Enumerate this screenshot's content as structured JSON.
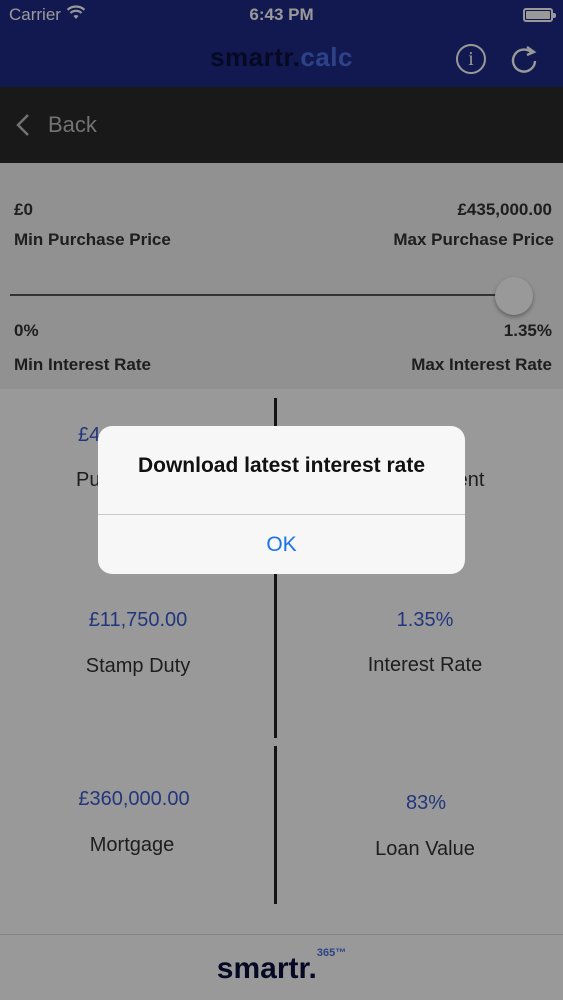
{
  "status_bar": {
    "carrier": "Carrier",
    "time": "6:43 PM"
  },
  "header": {
    "logo_main": "smartr.",
    "logo_accent": "calc",
    "info_icon": "info-icon",
    "refresh_icon": "refresh-icon"
  },
  "nav": {
    "back_label": "Back"
  },
  "slider": {
    "min_price_value": "£0",
    "min_price_label": "Min Purchase Price",
    "max_price_value": "£435,000.00",
    "max_price_label": "Max Purchase Price",
    "min_rate_value": "0%",
    "min_rate_label": "Min Interest Rate",
    "max_rate_value": "1.35%",
    "max_rate_label": "Max Interest Rate",
    "level": 1.0
  },
  "results": {
    "purchase_value_visible": "£4",
    "purchase_label_visible": "Pu",
    "repayment_label_visible": "ment",
    "stamp_duty_value": "£11,750.00",
    "stamp_duty_label": "Stamp Duty",
    "interest_rate_value": "1.35%",
    "interest_rate_label": "Interest Rate",
    "mortgage_value": "£360,000.00",
    "mortgage_label": "Mortgage",
    "loan_value_value": "83%",
    "loan_value_label": "Loan Value"
  },
  "footer": {
    "logo_main": "smartr.",
    "logo_sup": "365™"
  },
  "alert": {
    "title": "Download latest interest rate",
    "ok_label": "OK"
  },
  "colors": {
    "brand_blue": "#1f2a86",
    "accent_blue": "#3a5bd1",
    "alert_button": "#1a73e8"
  }
}
